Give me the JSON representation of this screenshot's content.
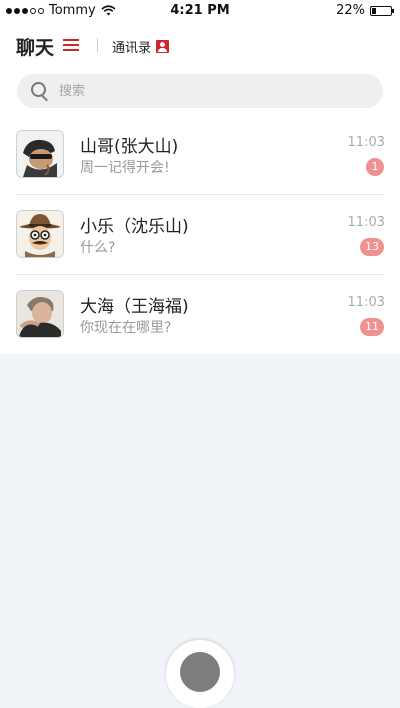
{
  "status_bar": {
    "carrier": "Tommy",
    "time": "4:21 PM",
    "battery_text": "22%",
    "battery_level": 0.22,
    "signal_dots": [
      true,
      true,
      true,
      false,
      false
    ],
    "wifi_icon": "wifi-icon"
  },
  "header": {
    "title": "聊天",
    "menu_icon": "hamburger-menu-icon",
    "contacts_label": "通讯录",
    "contacts_icon": "contacts-book-icon",
    "accent_color": "#d0262a"
  },
  "search": {
    "placeholder": "搜索",
    "icon": "search-icon"
  },
  "chats": [
    {
      "name": "山哥(张大山)",
      "preview": "周一记得开会!",
      "time": "11:03",
      "unread": "1",
      "avatar": "avatar-man-with-sunglasses"
    },
    {
      "name": "小乐（沈乐山)",
      "preview": "什么?",
      "time": "11:03",
      "unread": "13",
      "avatar": "avatar-cartoon-cowboy"
    },
    {
      "name": "大海（王海福)",
      "preview": "你现在在哪里?",
      "time": "11:03",
      "unread": "11",
      "avatar": "avatar-young-man"
    }
  ],
  "colors": {
    "badge": "#f09090",
    "background": "#f0f3f8"
  }
}
